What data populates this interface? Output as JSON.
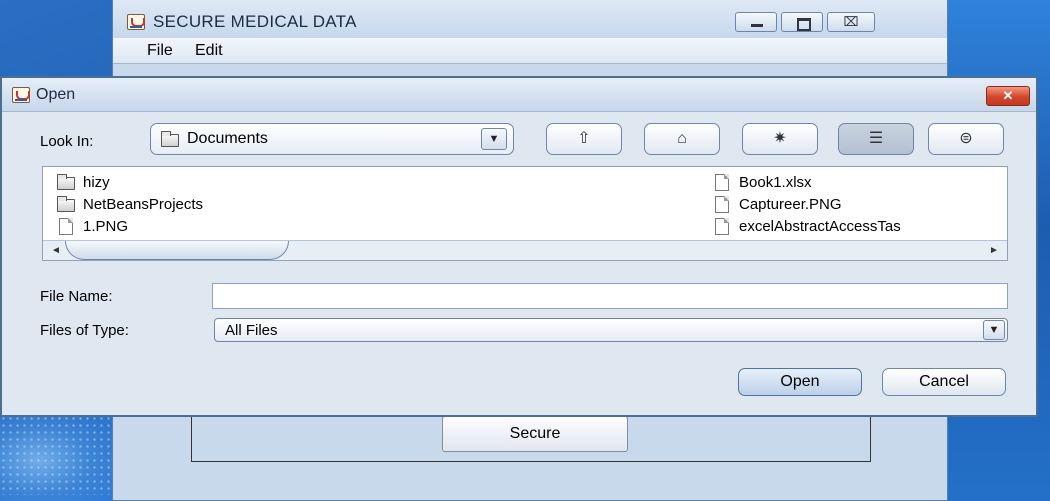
{
  "main_window": {
    "title": "SECURE MEDICAL DATA",
    "menu": {
      "file": "File",
      "edit": "Edit"
    },
    "window_buttons": {
      "minimize_icon": "minimize-icon",
      "maximize_icon": "maximize-icon",
      "close_glyph": "⌧"
    },
    "secure_button": "Secure"
  },
  "dialog": {
    "title": "Open",
    "close_glyph": "✕",
    "look_in": {
      "label": "Look In:",
      "value": "Documents"
    },
    "toolbar": [
      {
        "name": "up-one-level-icon",
        "glyph": "⇧"
      },
      {
        "name": "home-icon",
        "glyph": "⌂"
      },
      {
        "name": "new-folder-icon",
        "glyph": "✷"
      },
      {
        "name": "list-view-icon",
        "glyph": "☰"
      },
      {
        "name": "details-view-icon",
        "glyph": "⊜"
      }
    ],
    "files": [
      {
        "name": "hizy",
        "type": "folder"
      },
      {
        "name": "NetBeansProjects",
        "type": "folder"
      },
      {
        "name": "1.PNG",
        "type": "file"
      },
      {
        "name": "Book1.xlsx",
        "type": "file"
      },
      {
        "name": "Captureer.PNG",
        "type": "file"
      },
      {
        "name": "excelAbstractAccessTas",
        "type": "file"
      }
    ],
    "file_name": {
      "label": "File Name:",
      "value": ""
    },
    "files_of_type": {
      "label": "Files of Type:",
      "value": "All Files"
    },
    "buttons": {
      "open": "Open",
      "cancel": "Cancel"
    }
  },
  "colors": {
    "desktop": "#1f5fb3",
    "window_bg": "#c9d9ec",
    "dialog_bg": "#dfe7f1",
    "dialog_close": "#d2472b"
  }
}
